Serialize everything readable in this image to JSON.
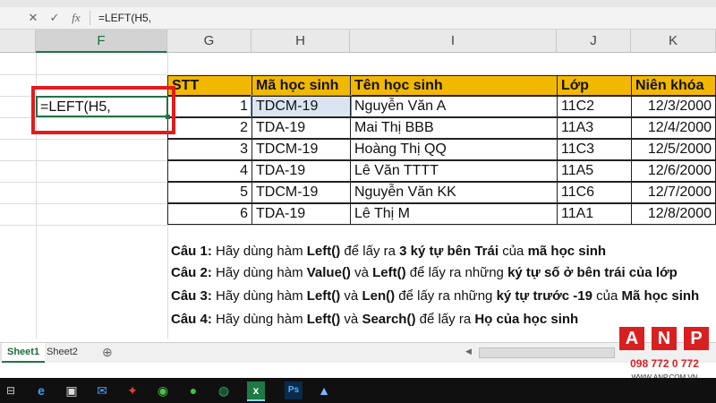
{
  "formula_bar": {
    "cancel_icon": "✕",
    "enter_icon": "✓",
    "fx_label": "fx",
    "formula": "=LEFT(H5,"
  },
  "columns": [
    "F",
    "G",
    "H",
    "I",
    "J",
    "K"
  ],
  "active_cell": {
    "ref": "F5",
    "value": "=LEFT(H5,"
  },
  "table": {
    "headers": [
      "STT",
      "Mã học sinh",
      "Tên học sinh",
      "Lớp",
      "Niên khóa"
    ],
    "rows": [
      [
        "1",
        "TDCM-19",
        "Nguyễn Văn A",
        "11C2",
        "12/3/2000"
      ],
      [
        "2",
        "TDA-19",
        "Mai Thị BBB",
        "11A3",
        "12/4/2000"
      ],
      [
        "3",
        "TDCM-19",
        "Hoàng Thị QQ",
        "11C3",
        "12/5/2000"
      ],
      [
        "4",
        "TDA-19",
        "Lê Văn TTTT",
        "11A5",
        "12/6/2000"
      ],
      [
        "5",
        "TDCM-19",
        "Nguyễn Văn KK",
        "11C6",
        "12/7/2000"
      ],
      [
        "6",
        "TDA-19",
        "Lê Thị M",
        "11A1",
        "12/8/2000"
      ]
    ]
  },
  "questions": [
    {
      "label": "Câu 1:",
      "text": " Hãy dùng hàm ",
      "b1": "Left()",
      "t2": " để lấy ra ",
      "b2": "3 ký tự bên Trái",
      "t3": " của ",
      "b3": "mã học sinh"
    },
    {
      "label": "Câu 2:",
      "text": " Hãy dùng hàm ",
      "b1": "Value()",
      "t2": " và ",
      "b2": "Left()",
      "t3": " để lấy ra những ",
      "b3": "ký tự số ở bên trái của lớp"
    },
    {
      "label": "Câu 3:",
      "text": " Hãy dùng hàm ",
      "b1": "Left()",
      "t2": " và ",
      "b2": "Len()",
      "t3": " để lấy ra  những ",
      "b3": "ký tự trước -19",
      "t4": " của ",
      "b4": "Mã học sinh"
    },
    {
      "label": "Câu 4:",
      "text": " Hãy dùng hàm ",
      "b1": "Left()",
      "t2": " và ",
      "b2": "Search()",
      "t3": " để lấy ra ",
      "b3": "Họ của học sinh"
    }
  ],
  "sheet_tabs": [
    "Sheet1",
    "Sheet2"
  ],
  "add_sheet_icon": "⊕",
  "logo": {
    "letters": [
      "A",
      "N",
      "P"
    ],
    "phone": "098 772 0 772",
    "url": "WWW.ANP.COM.VN"
  },
  "colors": {
    "header_fill": "#f2b800",
    "selection_red": "#e21b1b",
    "excel_green": "#217346"
  }
}
